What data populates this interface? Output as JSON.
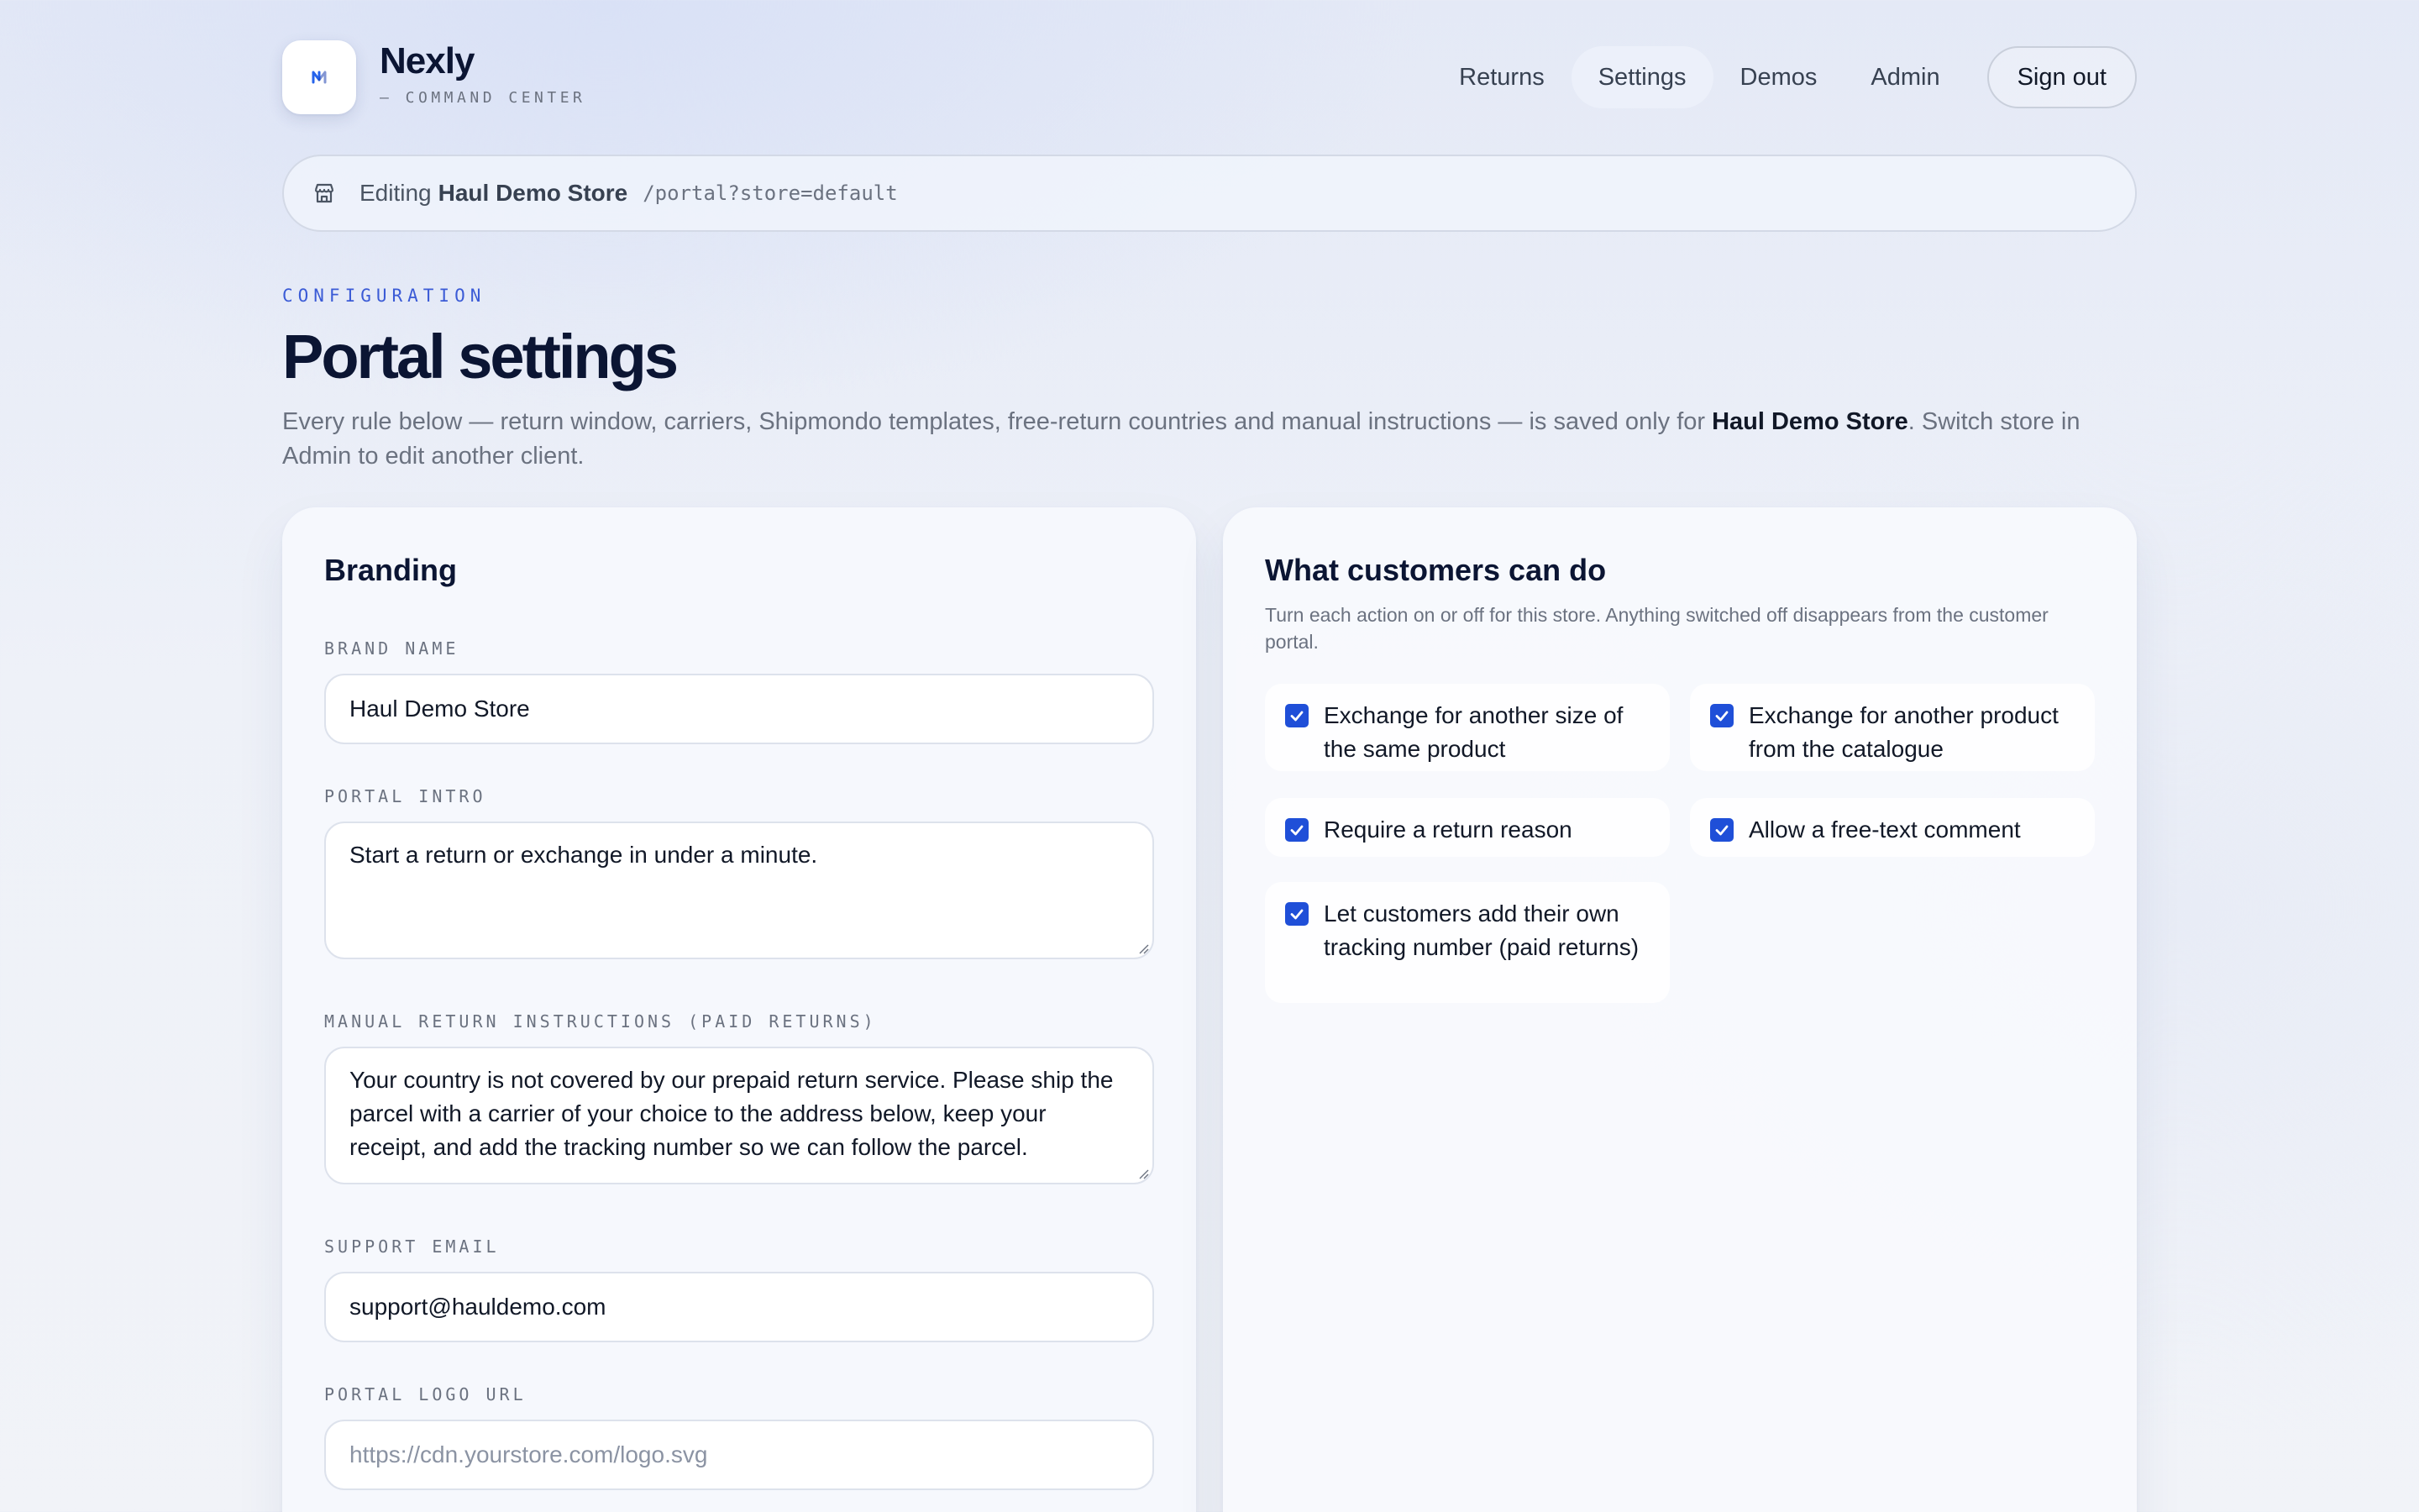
{
  "brand": {
    "name": "Nexly",
    "tagline": "— COMMAND CENTER"
  },
  "nav": {
    "items": [
      {
        "label": "Returns",
        "active": false
      },
      {
        "label": "Settings",
        "active": true
      },
      {
        "label": "Demos",
        "active": false
      },
      {
        "label": "Admin",
        "active": false
      }
    ],
    "signout_label": "Sign out"
  },
  "editbar": {
    "prefix": "Editing",
    "store": "Haul Demo Store",
    "path": "/portal?store=default",
    "icon": "store-icon"
  },
  "page": {
    "eyebrow": "CONFIGURATION",
    "title": "Portal settings",
    "desc_before": "Every rule below — return window, carriers, Shipmondo templates, free-return countries and manual instructions — is saved only for ",
    "desc_store": "Haul Demo Store",
    "desc_after": ". Switch store in Admin to edit another client."
  },
  "branding": {
    "title": "Branding",
    "brand_name_label": "BRAND NAME",
    "brand_name_value": "Haul Demo Store",
    "portal_intro_label": "PORTAL INTRO",
    "portal_intro_value": "Start a return or exchange in under a minute.",
    "manual_label": "MANUAL RETURN INSTRUCTIONS (PAID RETURNS)",
    "manual_value": "Your country is not covered by our prepaid return service. Please ship the parcel with a carrier of your choice to the address below, keep your receipt, and add the tracking number so we can follow the parcel.",
    "support_email_label": "SUPPORT EMAIL",
    "support_email_value": "support@hauldemo.com",
    "logo_url_label": "PORTAL LOGO URL",
    "logo_url_placeholder": "https://cdn.yourstore.com/logo.svg"
  },
  "actions": {
    "title": "What customers can do",
    "desc": "Turn each action on or off for this store. Anything switched off disappears from the customer portal.",
    "options": [
      {
        "label": "Exchange for another size of the same product",
        "checked": true
      },
      {
        "label": "Exchange for another product from the catalogue",
        "checked": true
      },
      {
        "label": "Require a return reason",
        "checked": true
      },
      {
        "label": "Allow a free-text comment",
        "checked": true
      },
      {
        "label": "Let customers add their own tracking number (paid returns)",
        "checked": true
      }
    ]
  },
  "colors": {
    "accent": "#1f4fd8",
    "eyebrow": "#3b5bd6",
    "heading": "#0b1533"
  }
}
